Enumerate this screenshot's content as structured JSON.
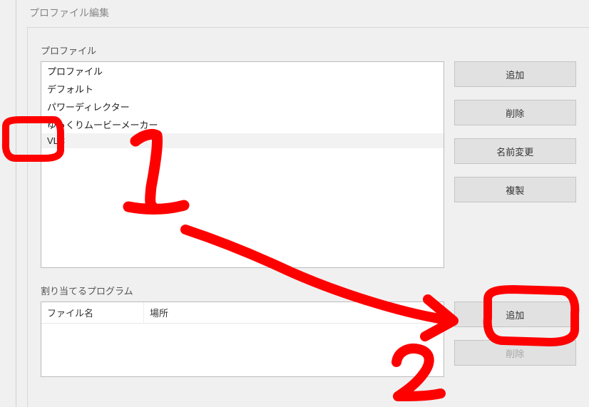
{
  "window": {
    "title": "プロファイル編集"
  },
  "profiles": {
    "label": "プロファイル",
    "items": [
      {
        "text": "プロファイル",
        "selected": false
      },
      {
        "text": "デフォルト",
        "selected": false
      },
      {
        "text": "パワーディレクター",
        "selected": false
      },
      {
        "text": "ゆっくりムービーメーカー",
        "selected": false
      },
      {
        "text": "VLC",
        "selected": true
      }
    ],
    "buttons": {
      "add": "追加",
      "delete": "削除",
      "rename": "名前変更",
      "duplicate": "複製"
    }
  },
  "assign": {
    "label": "割り当てるプログラム",
    "columns": {
      "filename": "ファイル名",
      "location": "場所"
    },
    "buttons": {
      "add": "追加",
      "delete": "削除"
    }
  },
  "annotations": {
    "step1": "1",
    "step2": "2"
  }
}
